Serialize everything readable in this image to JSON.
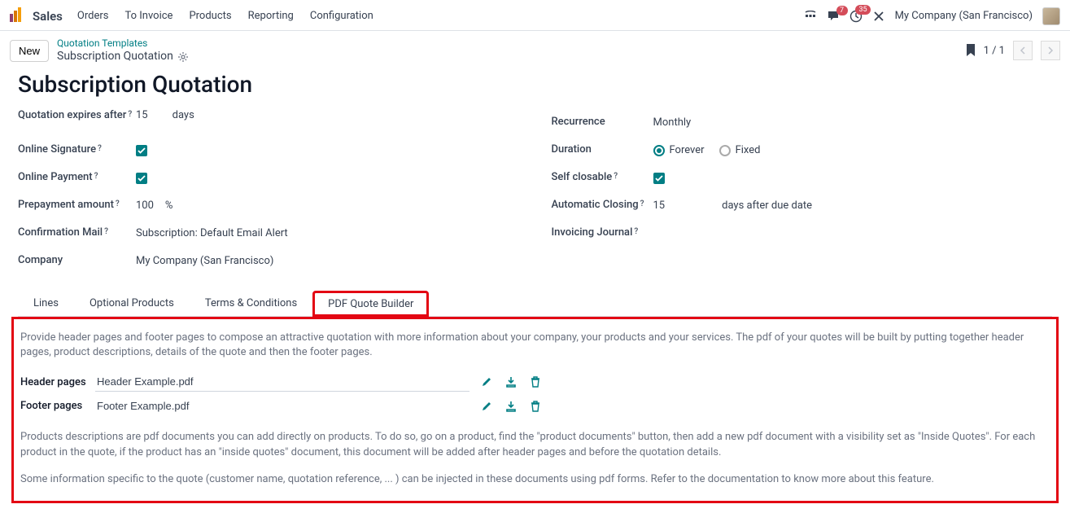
{
  "topnav": {
    "app": "Sales",
    "links": [
      "Orders",
      "To Invoice",
      "Products",
      "Reporting",
      "Configuration"
    ],
    "badge_chat": "7",
    "badge_clock": "35",
    "company": "My Company (San Francisco)"
  },
  "crumb": {
    "new_label": "New",
    "breadcrumb_top": "Quotation Templates",
    "breadcrumb_sub": "Subscription Quotation",
    "counter": "1 / 1"
  },
  "title": "Subscription Quotation",
  "left_fields": {
    "expires_label": "Quotation expires after",
    "expires_val": "15",
    "expires_unit": "days",
    "sig_label": "Online Signature",
    "pay_label": "Online Payment",
    "prepay_label": "Prepayment amount",
    "prepay_val": "100",
    "prepay_unit": "%",
    "mail_label": "Confirmation Mail",
    "mail_val": "Subscription: Default Email Alert",
    "company_label": "Company",
    "company_val": "My Company (San Francisco)"
  },
  "right_fields": {
    "recur_label": "Recurrence",
    "recur_val": "Monthly",
    "dur_label": "Duration",
    "dur_forever": "Forever",
    "dur_fixed": "Fixed",
    "selfclose_label": "Self closable",
    "autoclose_label": "Automatic Closing",
    "autoclose_val": "15",
    "autoclose_unit": "days after due date",
    "journal_label": "Invoicing Journal"
  },
  "tabs": [
    "Lines",
    "Optional Products",
    "Terms & Conditions",
    "PDF Quote Builder"
  ],
  "pdf_builder": {
    "intro": "Provide header pages and footer pages to compose an attractive quotation with more information about your company, your products and your services. The pdf of your quotes will be built by putting together header pages, product descriptions, details of the quote and then the footer pages.",
    "header_label": "Header pages",
    "header_file": "Header Example.pdf",
    "footer_label": "Footer pages",
    "footer_file": "Footer Example.pdf",
    "desc2": "Products descriptions are pdf documents you can add directly on products. To do so, go on a product, find the \"product documents\" button, then add a new pdf document with a visibility set as \"Inside Quotes\". For each product in the quote, if the product has an \"inside quotes\" document, this document will be added after header pages and before the quotation details.",
    "desc3": "Some information specific to the quote (customer name, quotation reference, ... ) can be injected in these documents using pdf forms. Refer to the documentation to know more about this feature."
  }
}
